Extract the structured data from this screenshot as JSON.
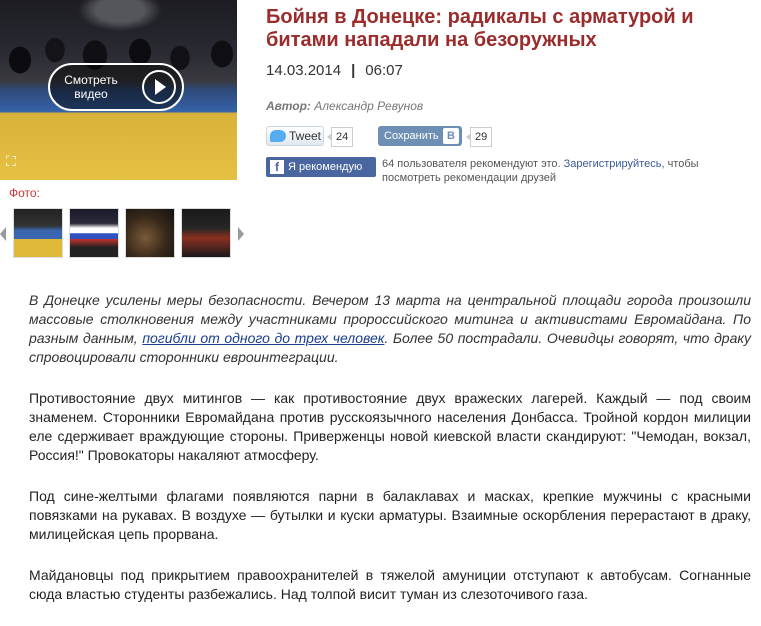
{
  "media": {
    "play_label_line1": "Смотреть",
    "play_label_line2": "видео",
    "photo_label": "Фото:"
  },
  "article": {
    "title": "Бойня в Донецке: радикалы с арматурой и битами нападали на безоружных",
    "date": "14.03.2014",
    "time": "06:07",
    "author_label": "Автор:",
    "author_name": "Александр Ревунов"
  },
  "share": {
    "tweet_label": "Tweet",
    "tweet_count": "24",
    "vk_label": "Сохранить",
    "vk_logo": "B",
    "vk_count": "29",
    "fb_label": "Я рекомендую",
    "fb_text_before": "64 пользователя рекомендуют это. ",
    "fb_link": "Зарегистрируйтесь,",
    "fb_text_after": " чтобы посмотреть рекомендации друзей"
  },
  "body": {
    "lead_before": "В Донецке усилены меры безопасности. Вечером 13 марта на центральной площади города произошли массовые столкновения между участниками пророссийского митинга и активистами Евромайдана. По разным данным, ",
    "lead_link": "погибли от одного до трех человек",
    "lead_after": ". Более 50 пострадали. Очевидцы говорят, что драку спровоцировали сторонники евроинтеграции.",
    "p2": "Противостояние двух митингов — как противостояние двух вражеских лагерей. Каждый — под своим знаменем. Сторонники Евромайдана против русскоязычного населения Донбасса. Тройной кордон милиции еле сдерживает враждующие стороны. Приверженцы новой киевской власти скандируют: \"Чемодан, вокзал, Россия!\" Провокаторы накаляют атмосферу.",
    "p3": "Под сине-желтыми флагами появляются парни в балаклавах и масках, крепкие мужчины с красными повязками на рукавах. В воздухе — бутылки и куски арматуры. Взаимные оскорбления перерастают в драку, милицейская цепь прорвана.",
    "p4": "Майдановцы под прикрытием правоохранителей в тяжелой амуниции отступают к автобусам. Согнанные сюда властью студенты разбежались. Над толпой висит туман из слезоточивого газа."
  }
}
